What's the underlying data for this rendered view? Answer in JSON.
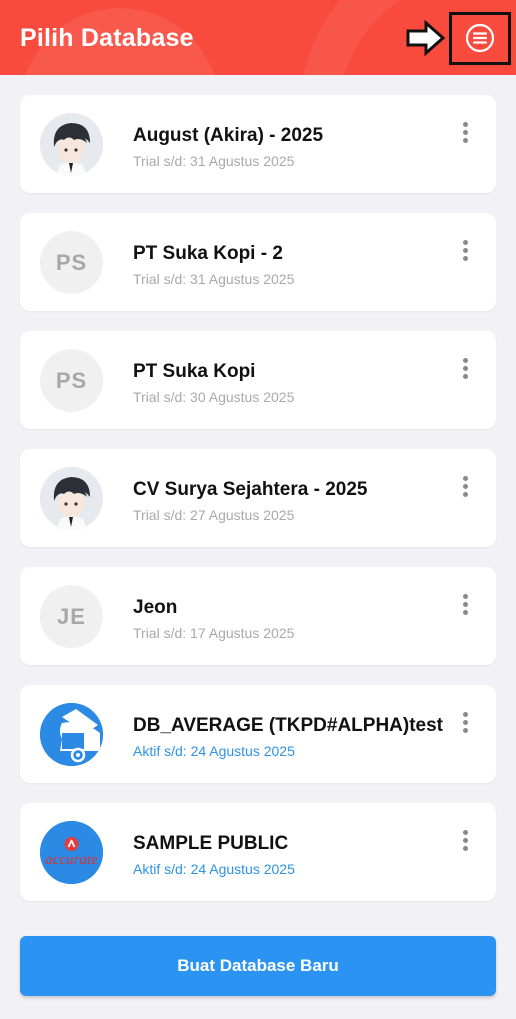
{
  "header": {
    "title": "Pilih Database",
    "menu_icon": "hamburger-menu-icon",
    "annotation_icon": "arrow-right-icon",
    "color": "#f94a3e"
  },
  "databases": [
    {
      "name": "August (Akira) - 2025",
      "status": "Trial s/d: 31 Agustus 2025",
      "avatar_type": "photo",
      "initials": ""
    },
    {
      "name": "PT Suka Kopi - 2",
      "status": "Trial s/d: 31 Agustus 2025",
      "avatar_type": "initials",
      "initials": "PS"
    },
    {
      "name": "PT Suka Kopi",
      "status": "Trial s/d: 30 Agustus 2025",
      "avatar_type": "initials",
      "initials": "PS"
    },
    {
      "name": "CV Surya Sejahtera - 2025",
      "status": "Trial s/d: 27 Agustus 2025",
      "avatar_type": "photo",
      "initials": ""
    },
    {
      "name": "Jeon",
      "status": "Trial s/d: 17 Agustus 2025",
      "avatar_type": "initials",
      "initials": "JE"
    },
    {
      "name": "DB_AVERAGE (TKPD#ALPHA)test",
      "status": "Aktif s/d: 24 Agustus 2025",
      "avatar_type": "truck-logo",
      "initials": ""
    },
    {
      "name": "SAMPLE PUBLIC",
      "status": "Aktif s/d: 24 Agustus 2025",
      "avatar_type": "accurate-logo",
      "initials": "",
      "logo_text": "accurate"
    }
  ],
  "create_button": {
    "label": "Buat Database Baru",
    "color": "#2b94f3"
  },
  "colors": {
    "trial_text": "#a9a9a9",
    "active_text": "#2d93e6"
  }
}
